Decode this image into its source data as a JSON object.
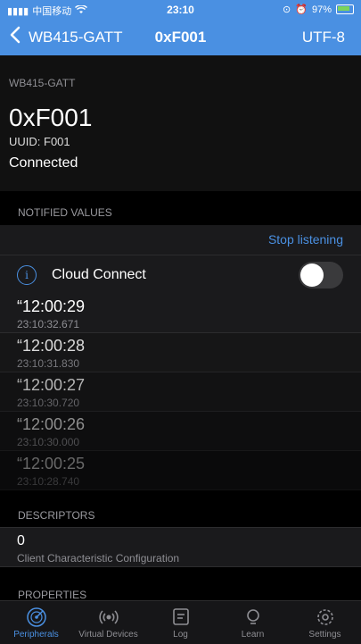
{
  "status": {
    "carrier": "中国移动",
    "time": "23:10",
    "battery": "97%"
  },
  "nav": {
    "back_label": "WB415-GATT",
    "title": "0xF001",
    "encoding": "UTF-8"
  },
  "header": {
    "service": "WB415-GATT",
    "name": "0xF001",
    "uuid": "UUID: F001",
    "status": "Connected"
  },
  "notified": {
    "section_title": "NOTIFIED VALUES",
    "stop_label": "Stop listening",
    "cloud_label": "Cloud Connect",
    "cloud_enabled": false,
    "items": [
      {
        "value": "“12:00:29",
        "timestamp": "23:10:32.671",
        "opacity": 1.0
      },
      {
        "value": "“12:00:28",
        "timestamp": "23:10:31.830",
        "opacity": 0.85
      },
      {
        "value": "“12:00:27",
        "timestamp": "23:10:30.720",
        "opacity": 0.7
      },
      {
        "value": "“12:00:26",
        "timestamp": "23:10:30.000",
        "opacity": 0.55
      },
      {
        "value": "“12:00:25",
        "timestamp": "23:10:28.740",
        "opacity": 0.4
      }
    ]
  },
  "descriptors": {
    "section_title": "DESCRIPTORS",
    "value": "0",
    "label": "Client Characteristic Configuration"
  },
  "properties": {
    "section_title": "PROPERTIES"
  },
  "tabs": [
    {
      "label": "Peripherals",
      "icon": "radar-icon",
      "active": true
    },
    {
      "label": "Virtual Devices",
      "icon": "broadcast-icon",
      "active": false
    },
    {
      "label": "Log",
      "icon": "log-icon",
      "active": false
    },
    {
      "label": "Learn",
      "icon": "learn-icon",
      "active": false
    },
    {
      "label": "Settings",
      "icon": "gear-icon",
      "active": false
    }
  ],
  "colors": {
    "accent": "#4a90e2",
    "background": "#000000"
  }
}
